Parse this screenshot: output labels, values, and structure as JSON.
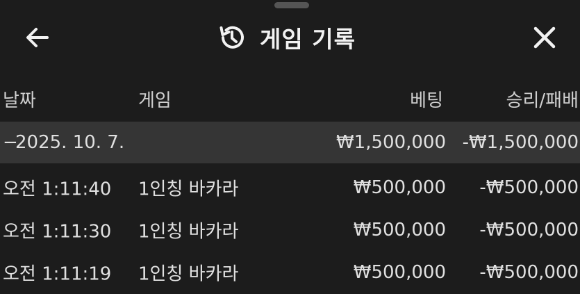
{
  "header": {
    "title": "게임 기록",
    "back_icon": "arrow-left-icon",
    "history_icon": "history-clock-icon",
    "close_icon": "close-icon"
  },
  "columns": {
    "date": "날짜",
    "game": "게임",
    "bet": "베팅",
    "win_loss": "승리/패배"
  },
  "group": {
    "toggle": "−",
    "date": "2025. 10. 7.",
    "bet": "₩1,500,000",
    "win_loss": "-₩1,500,000"
  },
  "rows": [
    {
      "time": "오전 1:11:40",
      "game": "1인칭 바카라",
      "bet": "₩500,000",
      "win_loss": "-₩500,000"
    },
    {
      "time": "오전 1:11:30",
      "game": "1인칭 바카라",
      "bet": "₩500,000",
      "win_loss": "-₩500,000"
    },
    {
      "time": "오전 1:11:19",
      "game": "1인칭 바카라",
      "bet": "₩500,000",
      "win_loss": "-₩500,000"
    }
  ],
  "colors": {
    "background": "#1c1c1c",
    "group_row": "#353535",
    "text": "#e0e0e0"
  }
}
